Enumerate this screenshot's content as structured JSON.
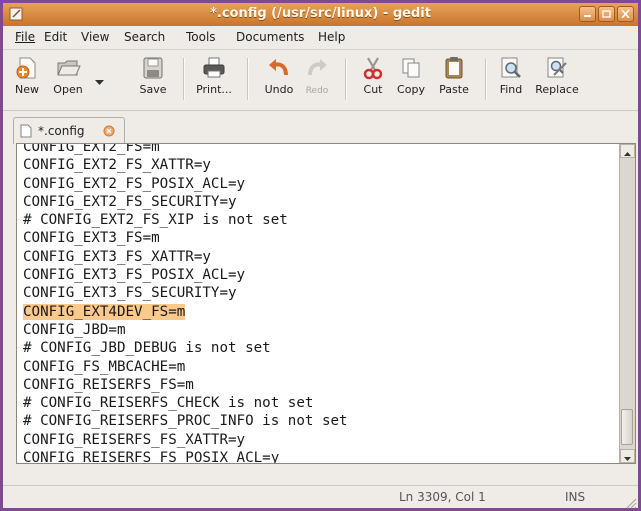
{
  "window": {
    "title": "*.config (/usr/src/linux) - gedit"
  },
  "menu": [
    "File",
    "Edit",
    "View",
    "Search",
    "Tools",
    "Documents",
    "Help"
  ],
  "toolbar": {
    "new": "New",
    "open": "Open",
    "save": "Save",
    "print": "Print...",
    "undo": "Undo",
    "redo": "Redo",
    "cut": "Cut",
    "copy": "Copy",
    "paste": "Paste",
    "find": "Find",
    "replace": "Replace"
  },
  "tab": {
    "label": "*.config"
  },
  "editor": {
    "highlighted_line": 10,
    "lines": [
      "CONFIG_EXT2_FS=m",
      "CONFIG_EXT2_FS_XATTR=y",
      "CONFIG_EXT2_FS_POSIX_ACL=y",
      "CONFIG_EXT2_FS_SECURITY=y",
      "# CONFIG_EXT2_FS_XIP is not set",
      "CONFIG_EXT3_FS=m",
      "CONFIG_EXT3_FS_XATTR=y",
      "CONFIG_EXT3_FS_POSIX_ACL=y",
      "CONFIG_EXT3_FS_SECURITY=y",
      "CONFIG_EXT4DEV_FS=m",
      "CONFIG_JBD=m",
      "# CONFIG_JBD_DEBUG is not set",
      "CONFIG_FS_MBCACHE=m",
      "CONFIG_REISERFS_FS=m",
      "# CONFIG_REISERFS_CHECK is not set",
      "# CONFIG_REISERFS_PROC_INFO is not set",
      "CONFIG_REISERFS_FS_XATTR=y",
      "CONFIG_REISERFS_FS_POSIX_ACL=y"
    ]
  },
  "status": {
    "position": "Ln 3309, Col 1",
    "mode": "INS"
  },
  "colors": {
    "titlebar": "#d8873f",
    "highlight": "#fbc98c",
    "border": "#7e4a92"
  }
}
